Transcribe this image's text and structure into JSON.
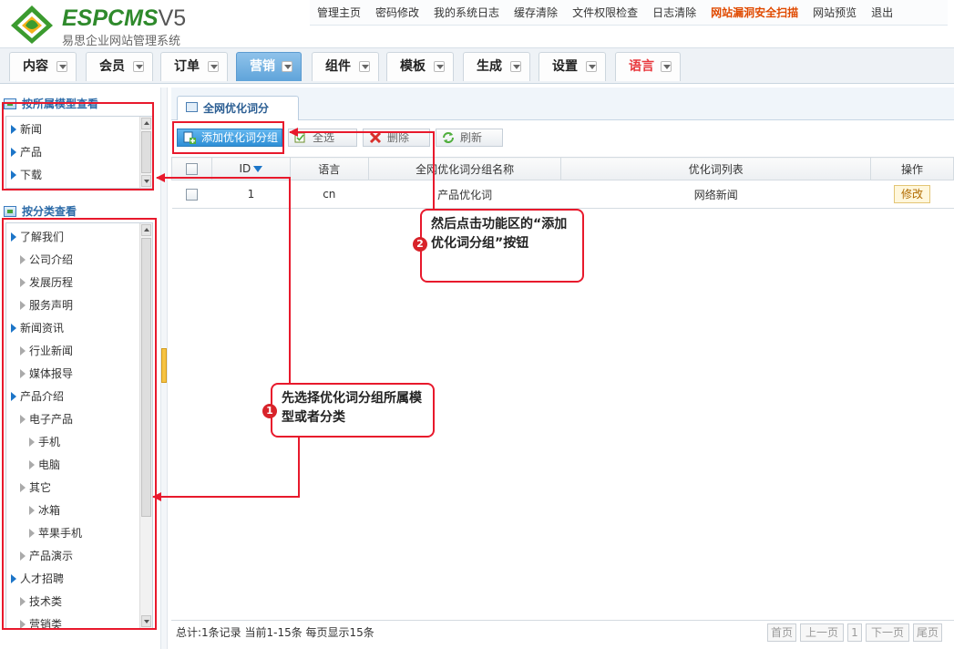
{
  "app": {
    "logo_text": "ESPCMS",
    "logo_version": "V5",
    "logo_subtitle": "易思企业网站管理系统"
  },
  "top_links": [
    {
      "label": "管理主页"
    },
    {
      "label": "密码修改"
    },
    {
      "label": "我的系统日志"
    },
    {
      "label": "缓存清除"
    },
    {
      "label": "文件权限检查"
    },
    {
      "label": "日志清除"
    },
    {
      "label": "网站漏洞安全扫描",
      "alert": true
    },
    {
      "label": "网站预览"
    },
    {
      "label": "退出"
    }
  ],
  "main_nav": [
    {
      "label": "内容"
    },
    {
      "label": "会员"
    },
    {
      "label": "订单"
    },
    {
      "label": "营销",
      "active": true
    },
    {
      "label": "组件"
    },
    {
      "label": "模板"
    },
    {
      "label": "生成"
    },
    {
      "label": "设置"
    },
    {
      "label": "语言",
      "highlight": true
    }
  ],
  "sidebar": {
    "by_model_title": "按所属模型查看",
    "by_model_items": [
      "新闻",
      "产品",
      "下载"
    ],
    "by_category_title": "按分类查看",
    "by_category_items": [
      {
        "label": "了解我们",
        "level": 0
      },
      {
        "label": "公司介绍",
        "level": 1
      },
      {
        "label": "发展历程",
        "level": 1
      },
      {
        "label": "服务声明",
        "level": 1
      },
      {
        "label": "新闻资讯",
        "level": 0
      },
      {
        "label": "行业新闻",
        "level": 1
      },
      {
        "label": "媒体报导",
        "level": 1
      },
      {
        "label": "产品介绍",
        "level": 0
      },
      {
        "label": "电子产品",
        "level": 1
      },
      {
        "label": "手机",
        "level": 2
      },
      {
        "label": "电脑",
        "level": 2
      },
      {
        "label": "其它",
        "level": 1
      },
      {
        "label": "冰箱",
        "level": 2
      },
      {
        "label": "苹果手机",
        "level": 2
      },
      {
        "label": "产品演示",
        "level": 1
      },
      {
        "label": "人才招聘",
        "level": 0
      },
      {
        "label": "技术类",
        "level": 1
      },
      {
        "label": "营销类",
        "level": 1
      }
    ]
  },
  "content": {
    "tab_label": "全网优化词分",
    "toolbar": {
      "add_label": "添加优化词分组",
      "select_all_label": "全选",
      "delete_label": "删除",
      "refresh_label": "刷新"
    },
    "table": {
      "columns": [
        "ID",
        "语言",
        "全网优化词分组名称",
        "优化词列表",
        "操作"
      ],
      "rows": [
        {
          "id": "1",
          "lang": "cn",
          "name": "产品优化词",
          "list": "网络新闻",
          "action": "修改"
        }
      ]
    },
    "footer": {
      "summary": "总计:1条记录 当前1-15条 每页显示15条",
      "first": "首页",
      "prev": "上一页",
      "page": "1",
      "next": "下一页",
      "last": "尾页"
    }
  },
  "annotations": {
    "step1_badge": "1",
    "step1_text": "先选择优化词分组所属模型或者分类",
    "step2_badge": "2",
    "step2_text": "然后点击功能区的“添加优化词分组”按钮"
  },
  "colors": {
    "annotation_red": "#e8192c",
    "active_tab_blue": "#5fa4da",
    "alert_orange": "#e04a00"
  }
}
